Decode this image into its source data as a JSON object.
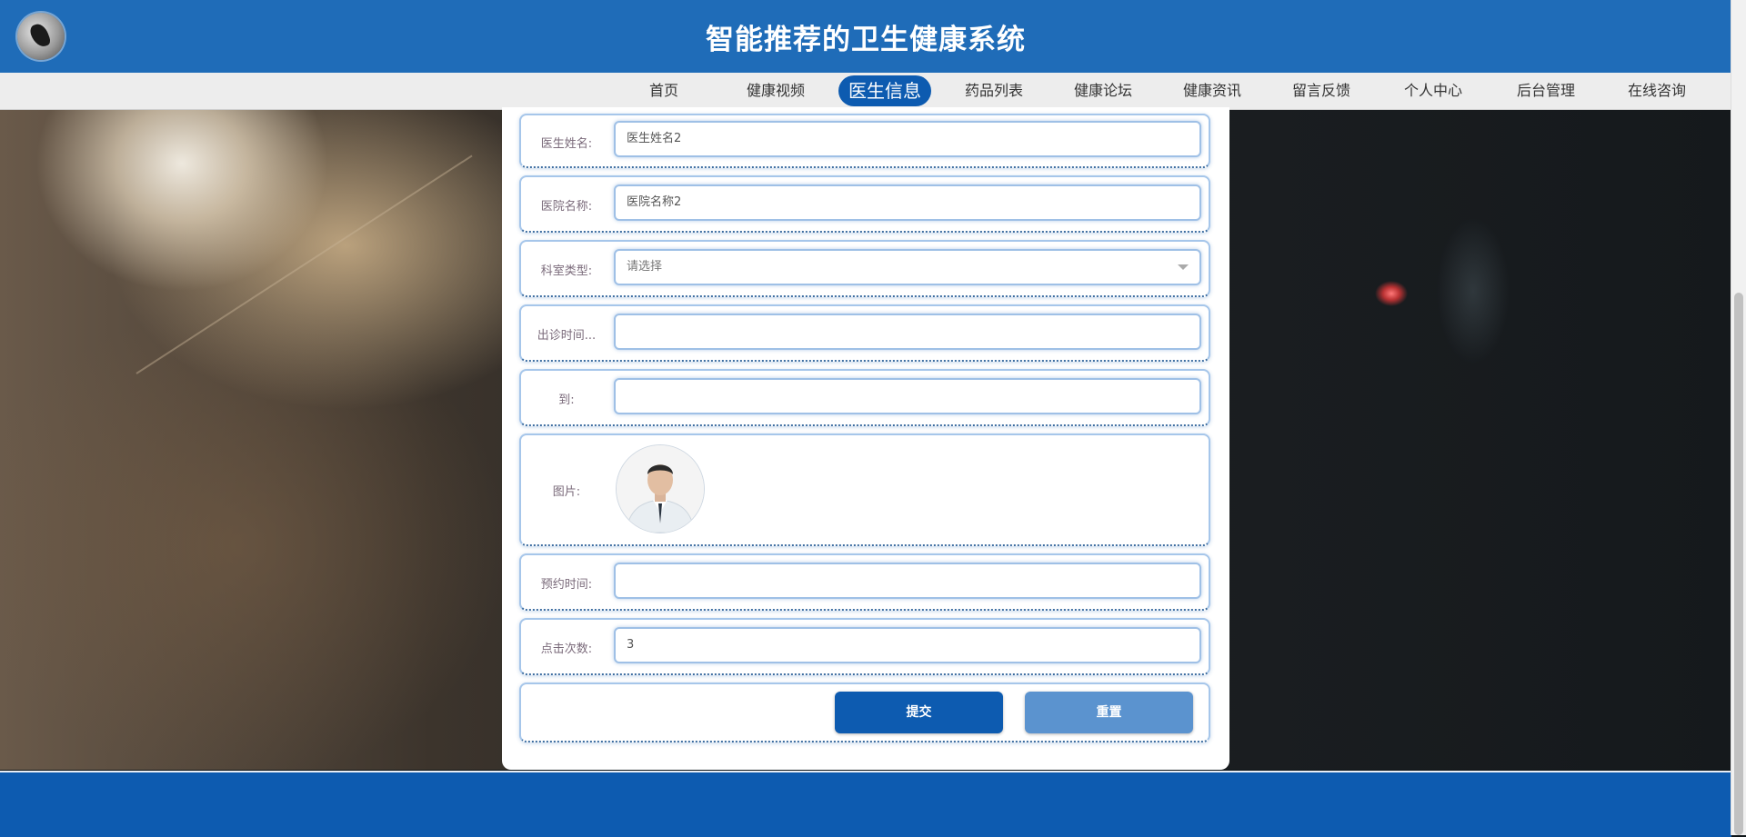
{
  "header": {
    "site_title": "智能推荐的卫生健康系统",
    "logo_icon": "site-logo-icon",
    "background_color": "#1f6cb8"
  },
  "nav": {
    "items": [
      {
        "label": "首页",
        "active": false
      },
      {
        "label": "健康视频",
        "active": false
      },
      {
        "label": "医生信息",
        "active": true
      },
      {
        "label": "药品列表",
        "active": false
      },
      {
        "label": "健康论坛",
        "active": false
      },
      {
        "label": "健康资讯",
        "active": false
      },
      {
        "label": "留言反馈",
        "active": false
      },
      {
        "label": "个人中心",
        "active": false
      },
      {
        "label": "后台管理",
        "active": false
      },
      {
        "label": "在线咨询",
        "active": false
      }
    ],
    "active_color": "#0d5bb0"
  },
  "form": {
    "doctor_name": {
      "label": "医生姓名:",
      "value": "医生姓名2"
    },
    "hospital_name": {
      "label": "医院名称:",
      "value": "医院名称2"
    },
    "department_type": {
      "label": "科室类型:",
      "value": "请选择",
      "icon": "chevron-down-icon"
    },
    "visit_time": {
      "label": "出诊时间...",
      "value": ""
    },
    "to": {
      "label": "到:",
      "value": ""
    },
    "picture": {
      "label": "图片:",
      "image": "doctor-photo"
    },
    "appointment_time": {
      "label": "预约时间:",
      "value": ""
    },
    "click_count": {
      "label": "点击次数:",
      "value": "3"
    },
    "buttons": {
      "submit_label": "提交",
      "reset_label": "重置",
      "submit_color": "#0d5bb0",
      "reset_color": "#5b93cf"
    }
  },
  "footer": {
    "background_color": "#0d5bb0"
  }
}
